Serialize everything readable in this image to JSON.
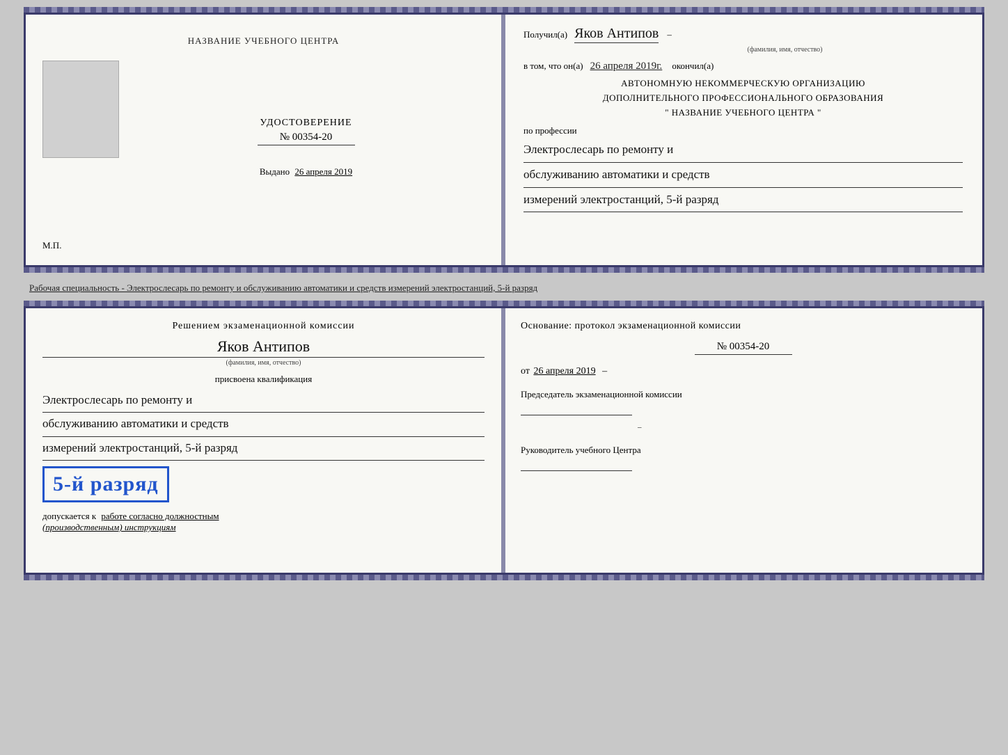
{
  "top_book": {
    "left": {
      "title": "НАЗВАНИЕ УЧЕБНОГО ЦЕНТРА",
      "cert_label": "УДОСТОВЕРЕНИЕ",
      "cert_number": "№ 00354-20",
      "issued_label": "Выдано",
      "issued_date": "26 апреля 2019",
      "mp_label": "М.П."
    },
    "right": {
      "received_label": "Получил(а)",
      "person_name": "Яков Антипов",
      "name_sublabel": "(фамилия, имя, отчество)",
      "completed_label": "в том, что он(а)",
      "completed_date": "26 апреля 2019г.",
      "completed_after": "окончил(а)",
      "org_line1": "АВТОНОМНУЮ НЕКОММЕРЧЕСКУЮ ОРГАНИЗАЦИЮ",
      "org_line2": "ДОПОЛНИТЕЛЬНОГО ПРОФЕССИОНАЛЬНОГО ОБРАЗОВАНИЯ",
      "org_line3": "\"  НАЗВАНИЕ УЧЕБНОГО ЦЕНТРА  \"",
      "profession_label": "по профессии",
      "profession_line1": "Электрослесарь по ремонту и",
      "profession_line2": "обслуживанию автоматики и средств",
      "profession_line3": "измерений электростанций, 5-й разряд"
    }
  },
  "separator": {
    "text": "Рабочая специальность - Электрослесарь по ремонту и обслуживанию автоматики и средств измерений электростанций, 5-й разряд"
  },
  "bottom_book": {
    "left": {
      "commission_title": "Решением экзаменационной комиссии",
      "person_name": "Яков Антипов",
      "name_sublabel": "(фамилия, имя, отчество)",
      "assigned_label": "присвоена квалификация",
      "qual_line1": "Электрослесарь по ремонту и",
      "qual_line2": "обслуживанию автоматики и средств",
      "qual_line3": "измерений электростанций, 5-й разряд",
      "rank_text": "5-й разряд",
      "admitted_text": "допускается к",
      "admitted_underline": "работе согласно должностным",
      "admitted_italic": "(производственным) инструкциям"
    },
    "right": {
      "basis_label": "Основание: протокол экзаменационной комиссии",
      "protocol_number": "№  00354-20",
      "date_prefix": "от",
      "date_value": "26 апреля 2019",
      "chairman_title": "Председатель экзаменационной комиссии",
      "head_title": "Руководитель учебного Центра"
    }
  }
}
